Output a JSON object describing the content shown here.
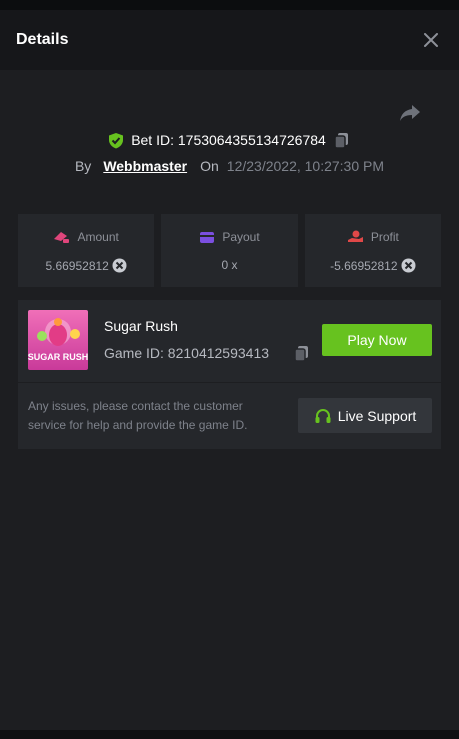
{
  "header": {
    "title": "Details"
  },
  "bet": {
    "id_text": "Bet ID: 1753064355134726784",
    "by_label": "By",
    "user": "Webbmaster",
    "on_label": "On",
    "date": "12/23/2022, 10:27:30 PM"
  },
  "stats": [
    {
      "label": "Amount",
      "value": "5.66952812",
      "icon": "amount-icon"
    },
    {
      "label": "Payout",
      "value": "0 x",
      "icon": "payout-icon"
    },
    {
      "label": "Profit",
      "value": "-5.66952812",
      "icon": "profit-icon"
    }
  ],
  "game": {
    "name": "Sugar Rush",
    "id_text": "Game ID: 8210412593413",
    "thumb_label": "SUGAR RUSH",
    "play_label": "Play Now",
    "issue_text": "Any issues, please contact the customer service for help and provide the game ID.",
    "support_label": "Live Support"
  },
  "colors": {
    "accent": "#67c21f",
    "panel": "#25272b",
    "background": "#1d1e21"
  }
}
